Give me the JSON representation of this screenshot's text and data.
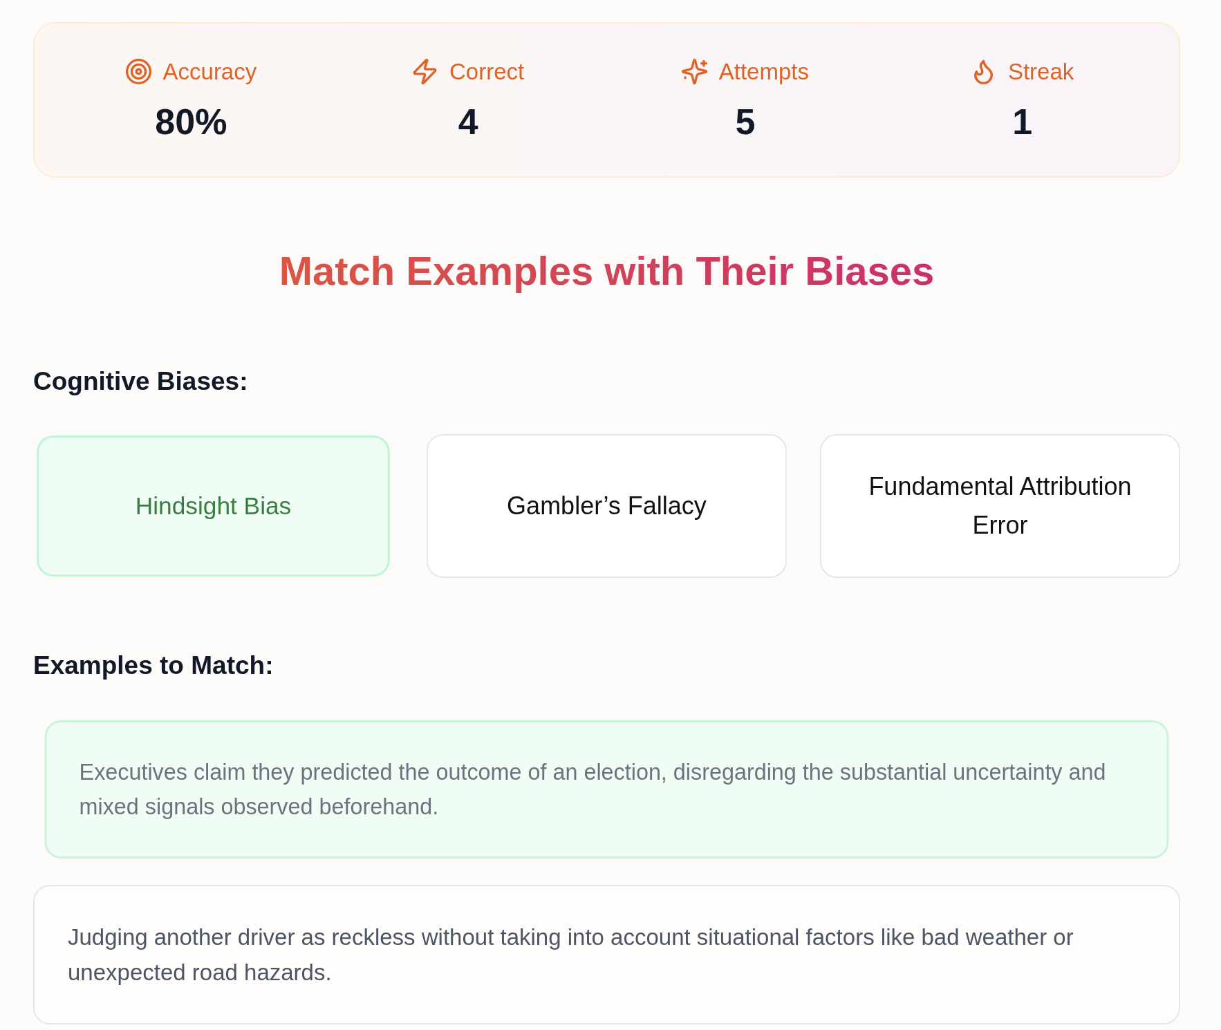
{
  "stats": [
    {
      "kind": "accuracy",
      "label": "Accuracy",
      "value": "80%"
    },
    {
      "kind": "correct",
      "label": "Correct",
      "value": "4"
    },
    {
      "kind": "attempts",
      "label": "Attempts",
      "value": "5"
    },
    {
      "kind": "streak",
      "label": "Streak",
      "value": "1"
    }
  ],
  "title": "Match Examples with Their Biases",
  "biases": {
    "heading": "Cognitive Biases:",
    "items": [
      {
        "label": "Hindsight Bias",
        "matched": true
      },
      {
        "label": "Gambler’s Fallacy",
        "matched": false
      },
      {
        "label": "Fundamental Attribution Error",
        "matched": false
      }
    ]
  },
  "examples": {
    "heading": "Examples to Match:",
    "items": [
      {
        "text": "Executives claim they predicted the outcome of an election, disregarding the substantial uncertainty and mixed signals observed beforehand.",
        "matched": true
      },
      {
        "text": "Judging another driver as reckless without taking into account situational factors like bad weather or unexpected road hazards.",
        "matched": false
      }
    ]
  }
}
